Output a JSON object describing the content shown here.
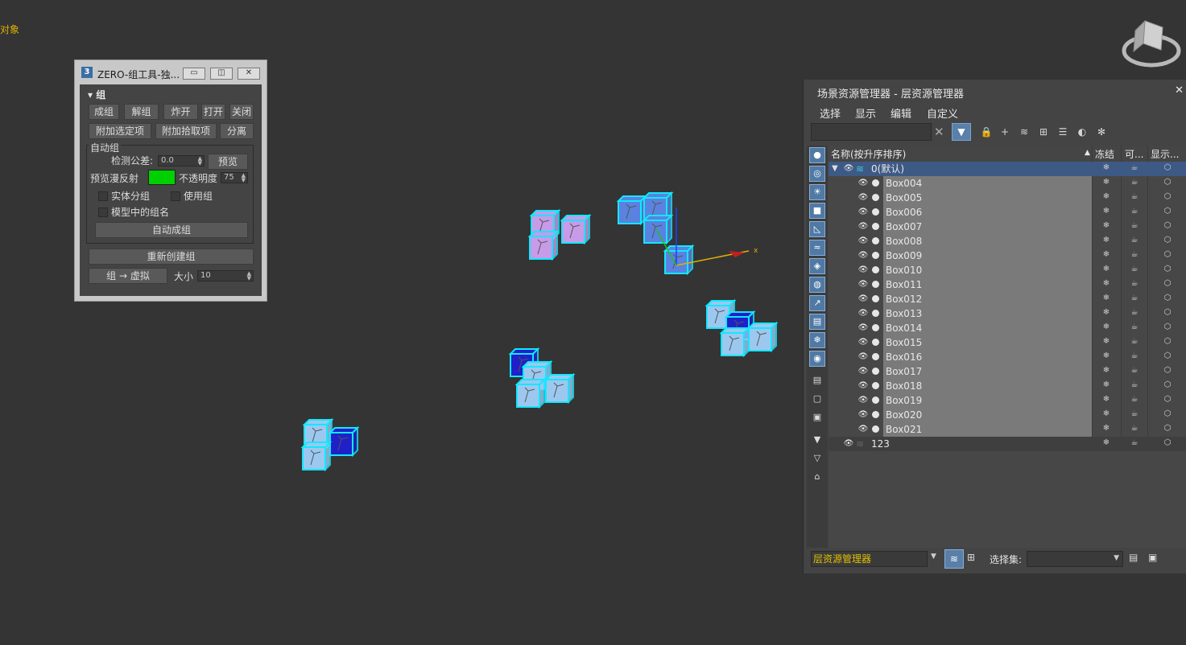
{
  "viewport": {
    "label": "对象"
  },
  "zero_panel": {
    "title": "ZERO-组工具-独...",
    "app_icon": "3",
    "section_title": "组",
    "buttons_row1": [
      "成组",
      "解组",
      "炸开",
      "打开",
      "关闭"
    ],
    "buttons_row2": [
      "附加选定项",
      "附加拾取项",
      "分离"
    ],
    "auto_group": {
      "title": "自动组",
      "tolerance_label": "检测公差:",
      "tolerance_value": "0.0",
      "preview_button": "预览",
      "preview_diffuse_label": "预览漫反射",
      "preview_color": "#00d000",
      "opacity_label": "不透明度",
      "opacity_value": "75",
      "solid_split_label": "实体分组",
      "use_group_label": "使用组",
      "group_name_in_model_label": "模型中的组名",
      "auto_group_button": "自动成组"
    },
    "recreate_button": "重新创建组",
    "group_to_dummy_button": "组 → 虚拟",
    "size_label": "大小",
    "size_value": "10"
  },
  "explorer": {
    "title": "场景资源管理器 - 层资源管理器",
    "menu": [
      "选择",
      "显示",
      "编辑",
      "自定义"
    ],
    "columns": {
      "name": "名称(按升序排序)",
      "freeze": "冻结",
      "visible": "可...",
      "display": "显示..."
    },
    "layers": [
      {
        "name": "0(默认)",
        "selected": true
      },
      {
        "name": "123",
        "selected": false
      }
    ],
    "objects": [
      "Box004",
      "Box005",
      "Box006",
      "Box007",
      "Box008",
      "Box009",
      "Box010",
      "Box011",
      "Box012",
      "Box013",
      "Box014",
      "Box015",
      "Box016",
      "Box017",
      "Box018",
      "Box019",
      "Box020",
      "Box021"
    ],
    "bottom": {
      "manager": "层资源管理器",
      "selection_set_label": "选择集:"
    },
    "accent": "#5a7fa8"
  }
}
